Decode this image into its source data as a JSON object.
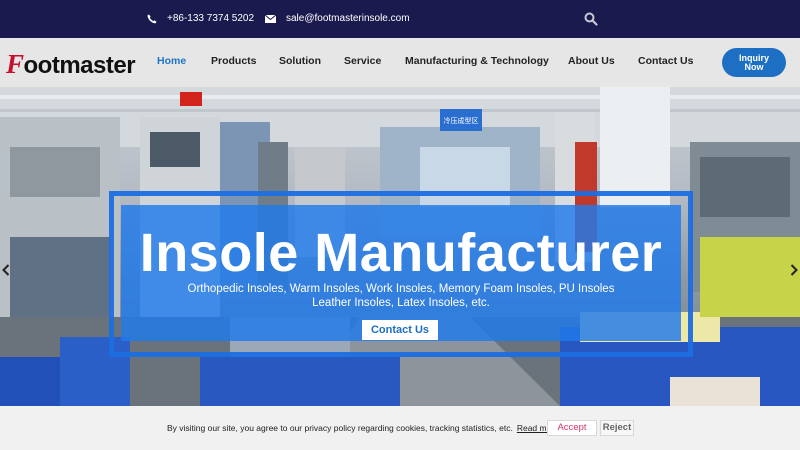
{
  "topbar": {
    "phone": "+86-133 7374 5202",
    "email": "sale@footmasterinsole.com",
    "icons": {
      "phone": "phone-icon",
      "email": "envelope-icon",
      "search": "search-icon"
    }
  },
  "brand": {
    "logo_first_letter": "F",
    "logo_rest": "ootmaster",
    "accent": "#c8102e"
  },
  "nav": {
    "items": [
      {
        "label": "Home",
        "active": true
      },
      {
        "label": "Products"
      },
      {
        "label": "Solution"
      },
      {
        "label": "Service"
      },
      {
        "label": "Manufacturing & Technology"
      },
      {
        "label": "About Us"
      },
      {
        "label": "Contact Us"
      }
    ],
    "inquiry_line1": "Inquiry",
    "inquiry_line2": "Now",
    "active_color": "#1d74c9",
    "button_color": "#1d6fc4"
  },
  "hero": {
    "title": "Insole Manufacturer",
    "subtitle_line1": "Orthopedic Insoles, Warm Insoles, Work Insoles, Memory Foam Insoles, PU Insoles",
    "subtitle_line2": "Leather Insoles, Latex Insoles, etc.",
    "button": "Contact Us",
    "sign_text": "冷压成型区",
    "prev_icon": "chevron-left-icon",
    "next_icon": "chevron-right-icon",
    "overlay_color": "#207aeb"
  },
  "cookie": {
    "message": "By visiting our site, you agree to our privacy policy regarding cookies, tracking statistics, etc.",
    "read_more": "Read more",
    "accept": "Accept",
    "reject": "Reject"
  }
}
